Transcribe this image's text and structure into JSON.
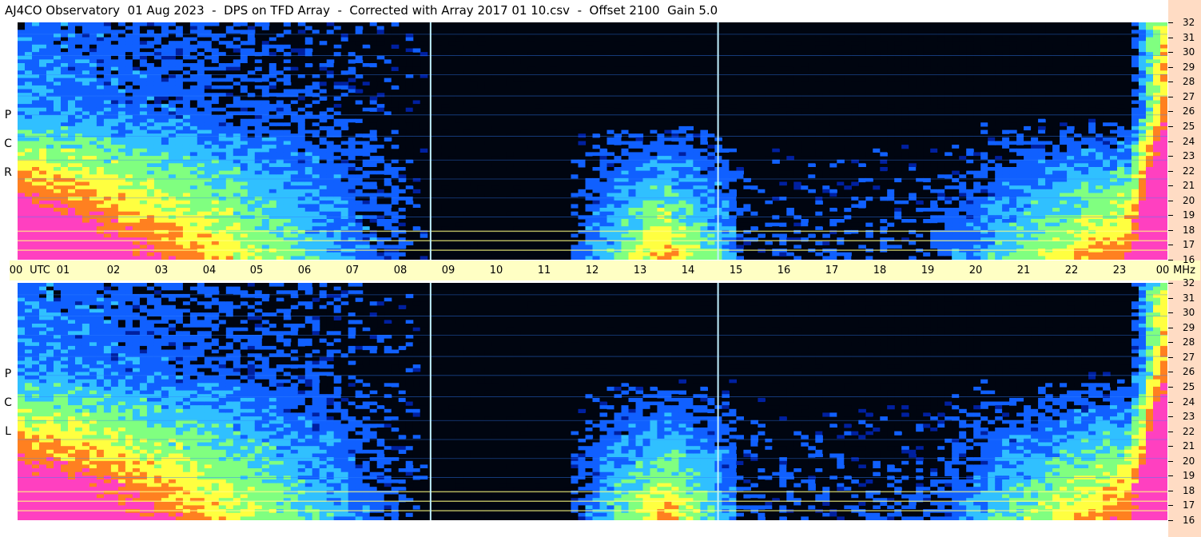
{
  "title": "AJ4CO Observatory  01 Aug 2023  -  DPS on TFD Array  -  Corrected with Array 2017 01 10.csv  -  Offset 2100  Gain 5.0",
  "panels": {
    "top": {
      "letters": [
        "P",
        "C",
        "R"
      ]
    },
    "bottom": {
      "letters": [
        "P",
        "C",
        "L"
      ]
    }
  },
  "colors": {
    "background": "#000510",
    "band_strip": "#ffdcc4",
    "utc_bar": "#ffffc4"
  },
  "chart_data": {
    "type": "heatmap",
    "x_axis": {
      "label": "UTC",
      "range": [
        0,
        24
      ],
      "ticks": [
        "00",
        "UTC",
        "01",
        "02",
        "03",
        "04",
        "05",
        "06",
        "07",
        "08",
        "09",
        "10",
        "11",
        "12",
        "13",
        "14",
        "15",
        "16",
        "17",
        "18",
        "19",
        "20",
        "21",
        "22",
        "23",
        "00"
      ],
      "unit_label": "MHz"
    },
    "y_axis": {
      "range": [
        16,
        32
      ],
      "ticks": [
        "32",
        "31",
        "30",
        "29",
        "28",
        "27",
        "26",
        "25",
        "24",
        "23",
        "22",
        "21",
        "20",
        "19",
        "18",
        "17",
        "16"
      ]
    },
    "colormap": [
      "#000510",
      "#0020a0",
      "#1060ff",
      "#30c0ff",
      "#80ff80",
      "#ffff40",
      "#ff8020",
      "#ff40c0"
    ]
  }
}
